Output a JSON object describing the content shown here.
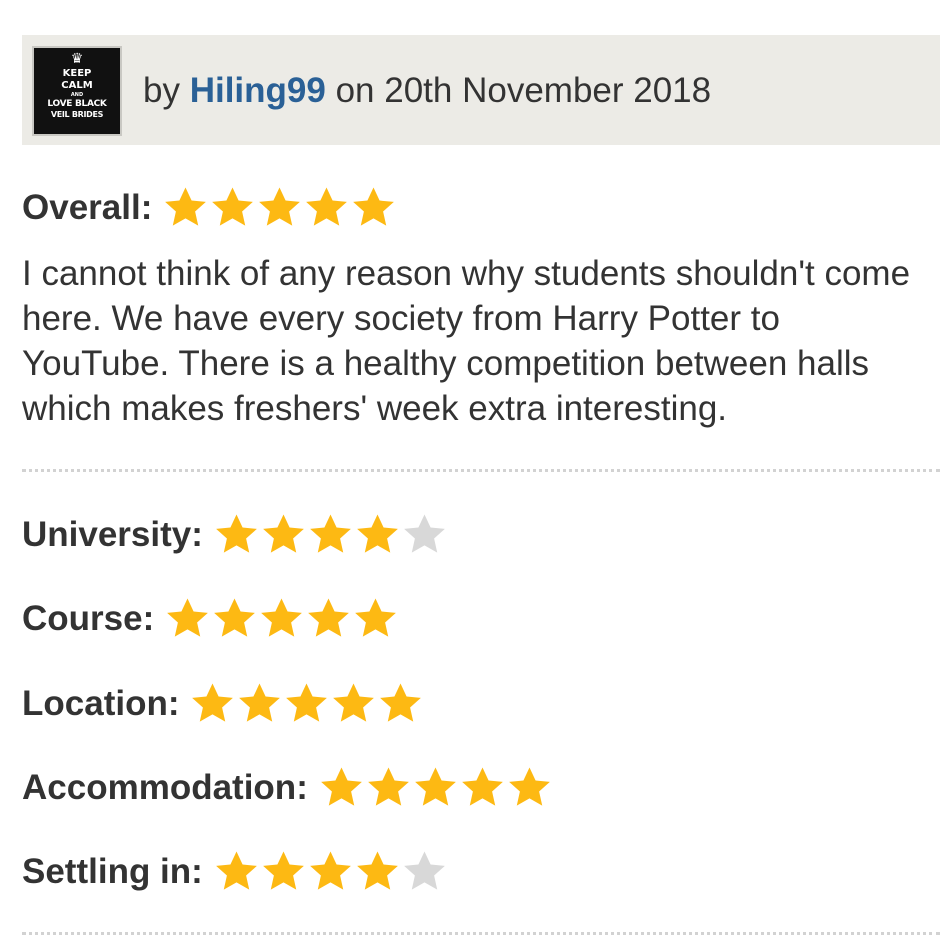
{
  "review": {
    "by_text": "by",
    "author": "Hiling99",
    "on_text": "on 20th November 2018",
    "avatar_text": [
      "KEEP",
      "CALM",
      "AND",
      "LOVE BLACK",
      "VEIL BRIDES"
    ],
    "overall": {
      "label": "Overall:",
      "rating": 5,
      "max": 5
    },
    "text": "I cannot think of any reason why students shouldn't come here. We have every society from Harry Potter to YouTube. There is a healthy competition between halls which makes freshers' week extra interesting.",
    "categories": [
      {
        "label": "University:",
        "rating": 4,
        "max": 5
      },
      {
        "label": "Course:",
        "rating": 5,
        "max": 5
      },
      {
        "label": "Location:",
        "rating": 5,
        "max": 5
      },
      {
        "label": "Accommodation:",
        "rating": 5,
        "max": 5
      },
      {
        "label": "Settling in:",
        "rating": 4,
        "max": 5
      }
    ]
  },
  "colors": {
    "star_filled": "#fdb913",
    "star_empty": "#d8d8d8",
    "author_link": "#2a6096",
    "header_bg": "#ecebe6"
  },
  "icons": {
    "star": "star-icon",
    "crown": "crown-icon"
  }
}
